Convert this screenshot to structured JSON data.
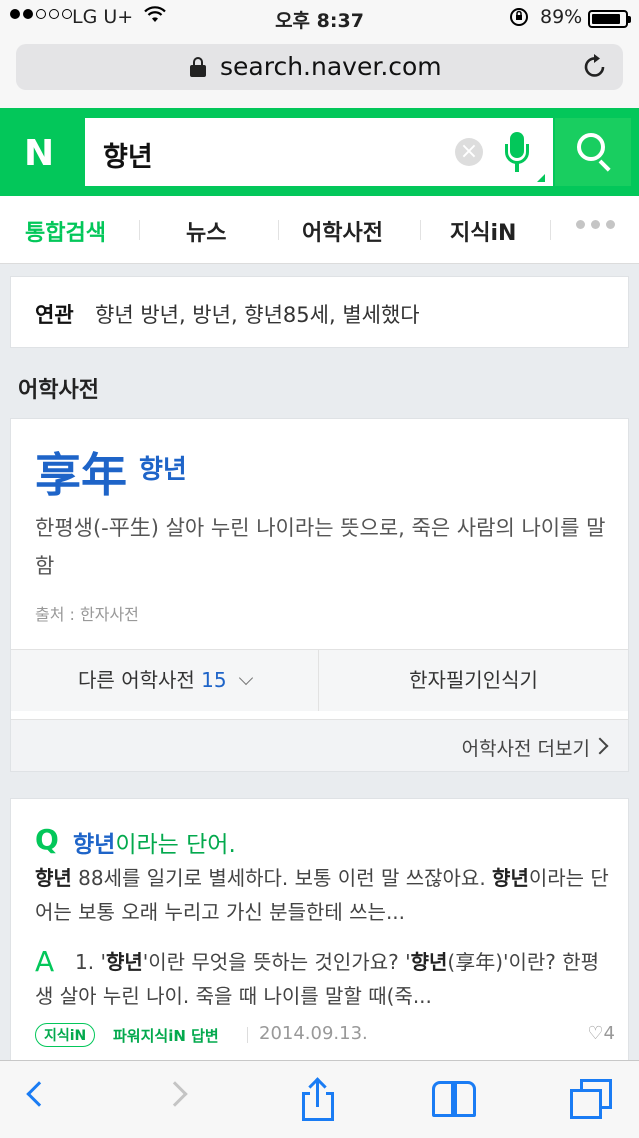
{
  "status_bar": {
    "signal_bars": "●●○○○",
    "carrier": "LG U+",
    "wifi_icon": "wifi-icon",
    "time": "오후 8:37",
    "battery_percent": "89%",
    "battery_level": 0.89
  },
  "browser": {
    "url": "search.naver.com",
    "lock_icon": "lock-icon",
    "reload_icon": "reload-icon"
  },
  "search": {
    "logo": "N",
    "query": "향년",
    "clear_glyph": "×",
    "brand_color": "#03c75a"
  },
  "tabs": [
    {
      "label": "통합검색",
      "active": true
    },
    {
      "label": "뉴스",
      "active": false
    },
    {
      "label": "어학사전",
      "active": false
    },
    {
      "label": "지식iN",
      "active": false
    }
  ],
  "related": {
    "label": "연관",
    "items_text": "향년 방년, 방년, 향년85세, 별세했다"
  },
  "dictionary": {
    "section_title": "어학사전",
    "hanja": "享年",
    "reading": "향년",
    "meaning": "한평생(-平生) 살아 누린 나이라는 뜻으로,     죽은 사람의 나이를 말함",
    "source": "출처 : 한자사전",
    "other_dicts_label": "다른 어학사전",
    "other_dicts_count": "15",
    "handwriting_label": "한자필기인식기",
    "more_label": "어학사전 더보기"
  },
  "kin": {
    "q_mark": "Q",
    "question_keyword": "향년",
    "question_rest": "이라는 단어.",
    "q_kw1": "향년",
    "q_text1": " 88세를 일기로 별세하다. 보통 이런 말 쓰잖아요. ",
    "q_kw2": "향년",
    "q_text2": "이라는 단어는 보통 오래 누리고 가신 분들한테 쓰는...",
    "a_mark": "A",
    "a_text1": "1. '",
    "a_kw1": "향년",
    "a_text2": "'이란 무엇을 뜻하는 것인가요? '",
    "a_kw2": "향년",
    "a_text3": "(享年)'이란? 한평생 살아 누린 나이. 죽을 때 나이를 말할 때(죽...",
    "badge": "지식iN",
    "answer_type": "파워지식iN 답변",
    "date": "2014.09.13.",
    "heart_glyph": "♡",
    "likes": "4"
  },
  "toolbar": {
    "back_icon": "back-icon",
    "forward_icon": "forward-icon",
    "share_icon": "share-icon",
    "bookmarks_icon": "bookmarks-icon",
    "tabs_icon": "tabs-icon"
  }
}
